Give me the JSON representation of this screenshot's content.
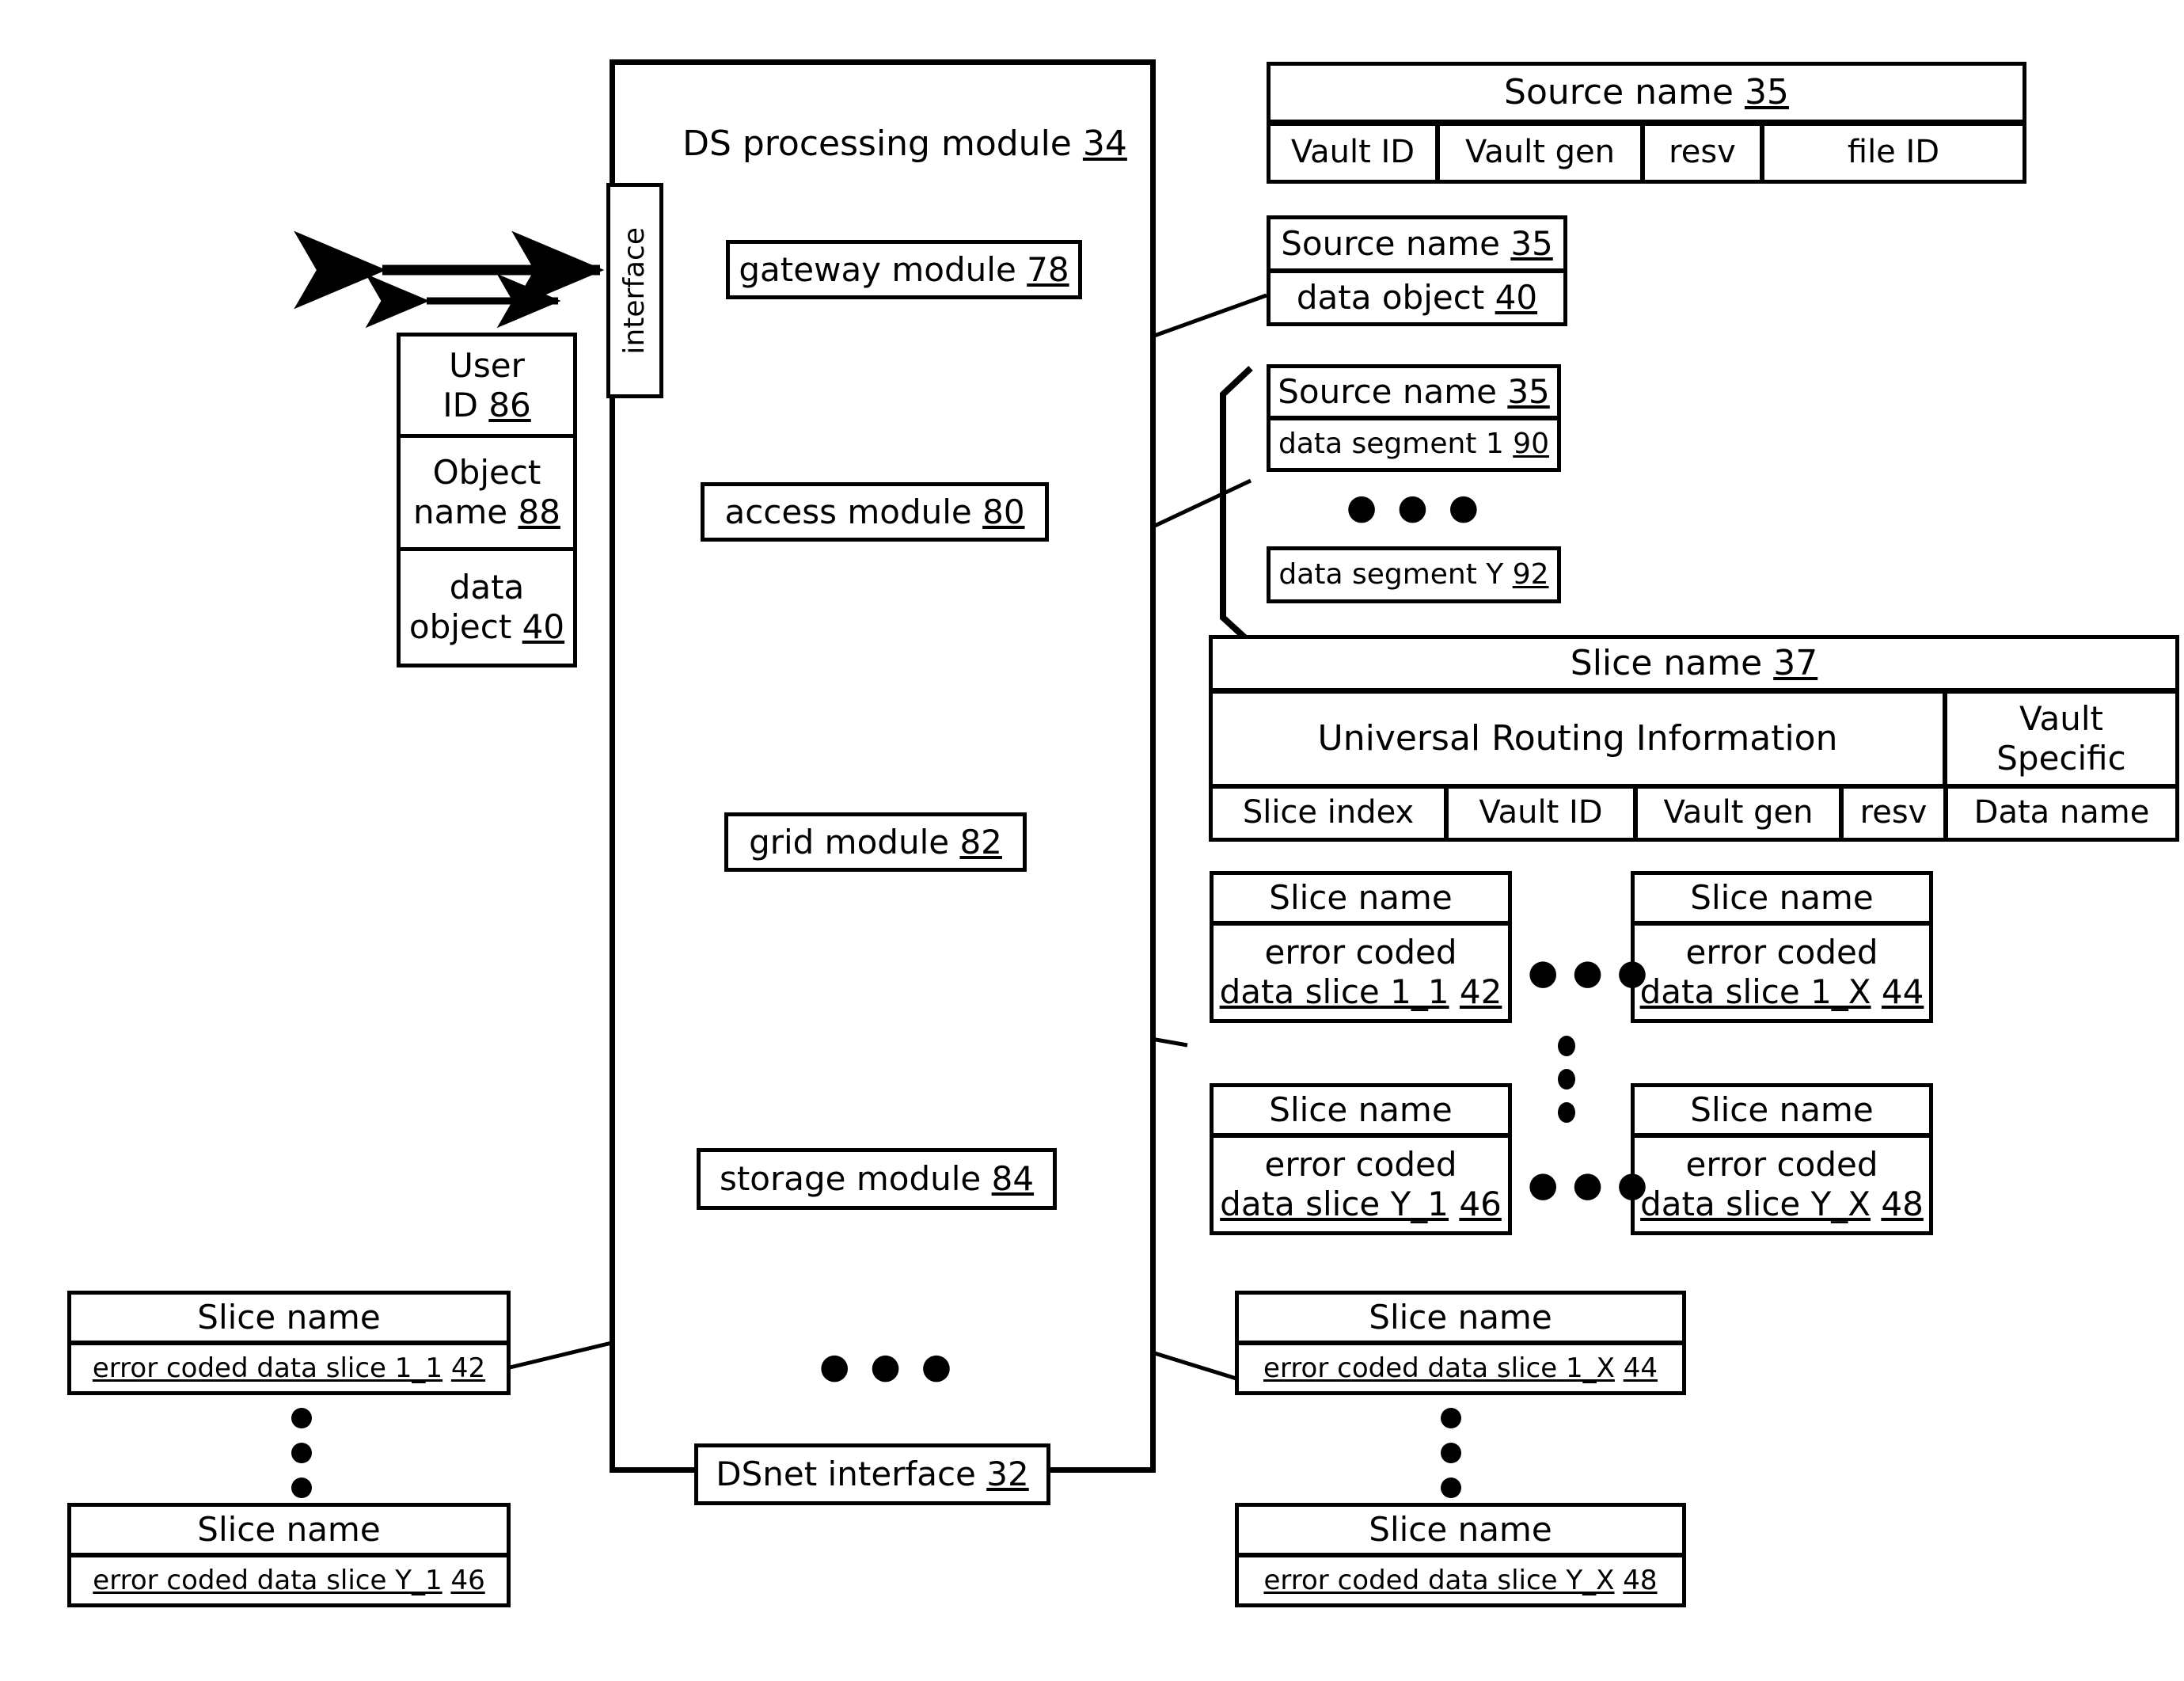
{
  "diagram": {
    "title_box": {
      "label": "DS processing module",
      "ref": "34"
    },
    "interface_label": "interface",
    "modules": [
      {
        "name": "gateway-module",
        "label": "gateway module",
        "ref": "78"
      },
      {
        "name": "access-module",
        "label": "access module",
        "ref": "80"
      },
      {
        "name": "grid-module",
        "label": "grid module",
        "ref": "82"
      },
      {
        "name": "storage-module",
        "label": "storage module",
        "ref": "84"
      },
      {
        "name": "dsnet-interface",
        "label": "DSnet interface",
        "ref": "32"
      }
    ],
    "user_stack": [
      {
        "line1": "User",
        "line2": "ID",
        "ref": "86"
      },
      {
        "line1": "Object",
        "line2": "name",
        "ref": "88"
      },
      {
        "line1": "data",
        "line2": "object",
        "ref": "40"
      }
    ],
    "source_name_table": {
      "header": "Source name",
      "header_ref": "35",
      "fields": [
        "Vault ID",
        "Vault gen",
        "resv",
        "file ID"
      ]
    },
    "source_object_box": {
      "header": "Source name",
      "header_ref": "35",
      "body": "data object",
      "body_ref": "40"
    },
    "source_segment_box": {
      "header": "Source name",
      "header_ref": "35",
      "segment_first": "data segment 1",
      "segment_first_ref": "90",
      "segment_last": "data segment Y",
      "segment_last_ref": "92",
      "ellipsis": "● ● ●"
    },
    "slice_name_table": {
      "header": "Slice name",
      "header_ref": "37",
      "group_left": "Universal Routing Information",
      "group_right_line1": "Vault",
      "group_right_line2": "Specific",
      "fields": [
        "Slice index",
        "Vault ID",
        "Vault gen",
        "resv",
        "Data name"
      ]
    },
    "slice_grid": [
      {
        "name": "slice-1-1",
        "header": "Slice name",
        "line1": "error coded",
        "line2": "data slice 1_1",
        "ref": "42"
      },
      {
        "name": "slice-1-x",
        "header": "Slice name",
        "line1": "error coded",
        "line2": "data slice 1_X",
        "ref": "44"
      },
      {
        "name": "slice-y-1",
        "header": "Slice name",
        "line1": "error coded",
        "line2": "data slice Y_1",
        "ref": "46"
      },
      {
        "name": "slice-y-x",
        "header": "Slice name",
        "line1": "error coded",
        "line2": "data slice Y_X",
        "ref": "48"
      }
    ],
    "bottom_left_slices": [
      {
        "name": "bottom-left-slice-1-1",
        "header": "Slice name",
        "body": "error coded data slice 1_1",
        "ref": "42"
      },
      {
        "name": "bottom-left-slice-y-1",
        "header": "Slice name",
        "body": "error coded data slice Y_1",
        "ref": "46"
      }
    ],
    "bottom_right_slices": [
      {
        "name": "bottom-right-slice-1-x",
        "header": "Slice name",
        "body": "error coded data slice 1_X",
        "ref": "44"
      },
      {
        "name": "bottom-right-slice-y-x",
        "header": "Slice name",
        "body": "error coded data slice Y_X",
        "ref": "48"
      }
    ],
    "ellipsis_horizontal": "● ● ●",
    "colors": {
      "line": "#000000",
      "background": "#ffffff"
    }
  }
}
